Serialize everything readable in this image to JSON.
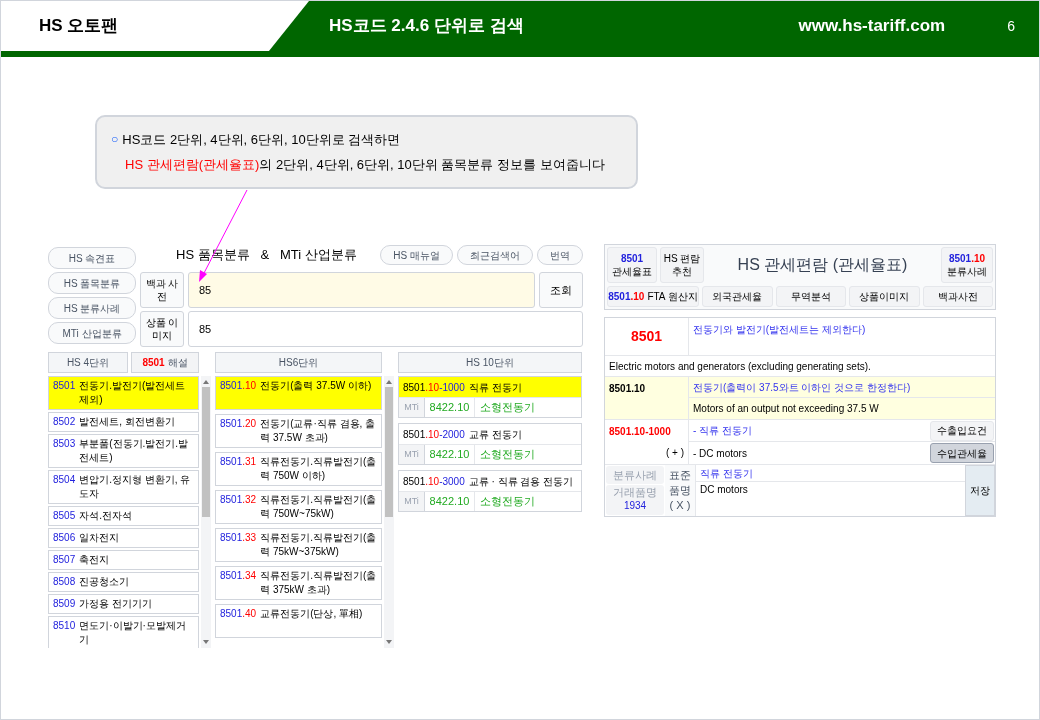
{
  "header": {
    "brand": "HS 오토팬",
    "title": "HS코드 2.4.6 단위로 검색",
    "url": "www.hs-tariff.com",
    "page": "6"
  },
  "callout": {
    "bullet": "○",
    "line1": "HS코드 2단위, 4단위, 6단위, 10단위로 검색하면",
    "line2_highlight": "HS 관세편람(관세율표)",
    "line2_rest": "의 2단위, 4단위, 6단위, 10단위 품목분류 정보를 보여줍니다"
  },
  "search_app": {
    "side_buttons": [
      "HS 속견표",
      "HS 품목분류",
      "HS 분류사례",
      "MTi 산업분류"
    ],
    "title": "HS 품목분류   &   MTi 산업분류",
    "top_buttons": [
      "HS 매뉴얼",
      "최근검색어",
      "번역"
    ],
    "search_rows": [
      {
        "label": "백과 사전",
        "value": "85"
      },
      {
        "label": "상품 이미지",
        "value": "85"
      }
    ],
    "search_button": "조회",
    "hs4_header": "HS 4단위",
    "note_header": {
      "code": "8501",
      "label": "해설"
    },
    "hs6_header": "HS6단위",
    "hs10_header": "HS 10단위",
    "hs4_items": [
      {
        "code": "8501",
        "name": "전동기.발전기(발전세트 제외)",
        "selected": true
      },
      {
        "code": "8502",
        "name": "발전세트, 회전변환기",
        "selected": false
      },
      {
        "code": "8503",
        "name": "부분품(전동기.발전기.발전세트)",
        "selected": false
      },
      {
        "code": "8504",
        "name": "변압기.정지형 변환기, 유도자",
        "selected": false
      },
      {
        "code": "8505",
        "name": "자석.전자석",
        "selected": false
      },
      {
        "code": "8506",
        "name": "일차전지",
        "selected": false
      },
      {
        "code": "8507",
        "name": "축전지",
        "selected": false
      },
      {
        "code": "8508",
        "name": "진공청소기",
        "selected": false
      },
      {
        "code": "8509",
        "name": "가정용 전기기기",
        "selected": false
      },
      {
        "code": "8510",
        "name": "면도기·이발기·모발제거기",
        "selected": false
      }
    ],
    "hs6_items": [
      {
        "code": "8501",
        "sub": ".10",
        "name": "전동기(출력 37.5W 이하)",
        "selected": true
      },
      {
        "code": "8501",
        "sub": ".20",
        "name": "전동기(교류·직류 겸용, 출력 37.5W 초과)",
        "selected": false
      },
      {
        "code": "8501",
        "sub": ".31",
        "name": "직류전동기.직류발전기(출력 750W 이하)",
        "selected": false
      },
      {
        "code": "8501",
        "sub": ".32",
        "name": "직류전동기.직류발전기(출력 750W~75kW)",
        "selected": false
      },
      {
        "code": "8501",
        "sub": ".33",
        "name": "직류전동기.직류발전기(출력 75kW~375kW)",
        "selected": false
      },
      {
        "code": "8501",
        "sub": ".34",
        "name": "직류전동기.직류발전기(출력 375kW 초과)",
        "selected": false
      },
      {
        "code": "8501",
        "sub": ".40",
        "name": "교류전동기(단상, 單相)",
        "selected": false
      }
    ],
    "hs10_items": [
      {
        "code": "8501",
        "sub": ".10",
        "ext": "-1000",
        "name": "직류 전동기",
        "selected": true,
        "mti_label": "MTi",
        "mti_code": "8422.10",
        "mti_name": "소형전동기"
      },
      {
        "code": "8501",
        "sub": ".10",
        "ext": "-2000",
        "name": "교류 전동기",
        "selected": false,
        "mti_label": "MTi",
        "mti_code": "8422.10",
        "mti_name": "소형전동기"
      },
      {
        "code": "8501",
        "sub": ".10",
        "ext": "-3000",
        "name": "교류 · 직류 겸용 전동기",
        "selected": false,
        "mti_label": "MTi",
        "mti_code": "8422.10",
        "mti_name": "소형전동기"
      }
    ]
  },
  "tariff_panel": {
    "tariff_button": {
      "code": "8501",
      "label": "관세율표"
    },
    "recommend_button": [
      "HS 편람",
      "추천"
    ],
    "title": "HS 관세편람 (관세율표)",
    "cases_button": {
      "code": "8501",
      "sub": ".10",
      "label": "분류사례"
    },
    "tabs": [
      {
        "kind": "code",
        "code": "8501",
        "sub": ".10",
        "label": "FTA 원산지"
      },
      {
        "kind": "plain",
        "label": "외국관세율"
      },
      {
        "kind": "plain",
        "label": "무역분석"
      },
      {
        "kind": "plain",
        "label": "상품이미지"
      },
      {
        "kind": "plain",
        "label": "백과사전"
      }
    ],
    "heading_code": "8501",
    "heading_ko": "전동기와 발전기(발전세트는 제외한다)",
    "heading_en": "Electric motors and generators (excluding generating sets).",
    "sub_code": "8501.10",
    "sub_ko": "전동기(출력이 37.5와트 이하인 것으로 한정한다)",
    "sub_en": "Motors of an output not exceeding 37.5 W",
    "item_code": "8501.10-1000",
    "item_mark": "( + )",
    "item_ko": "- 직류 전동기",
    "item_en": "- DC motors",
    "item_buttons": [
      {
        "label": "수출입요건",
        "selected": false
      },
      {
        "label": "수입관세율",
        "selected": true
      }
    ],
    "case_button": {
      "label": "분류사례",
      "disabled": true
    },
    "trade_button": {
      "label": "거래품명",
      "count": "1934",
      "disabled": true
    },
    "std_label": [
      "표준",
      "품명",
      "( X )"
    ],
    "std_ko": "직류 전동기",
    "std_en": "DC motors",
    "save_button": "저장"
  }
}
